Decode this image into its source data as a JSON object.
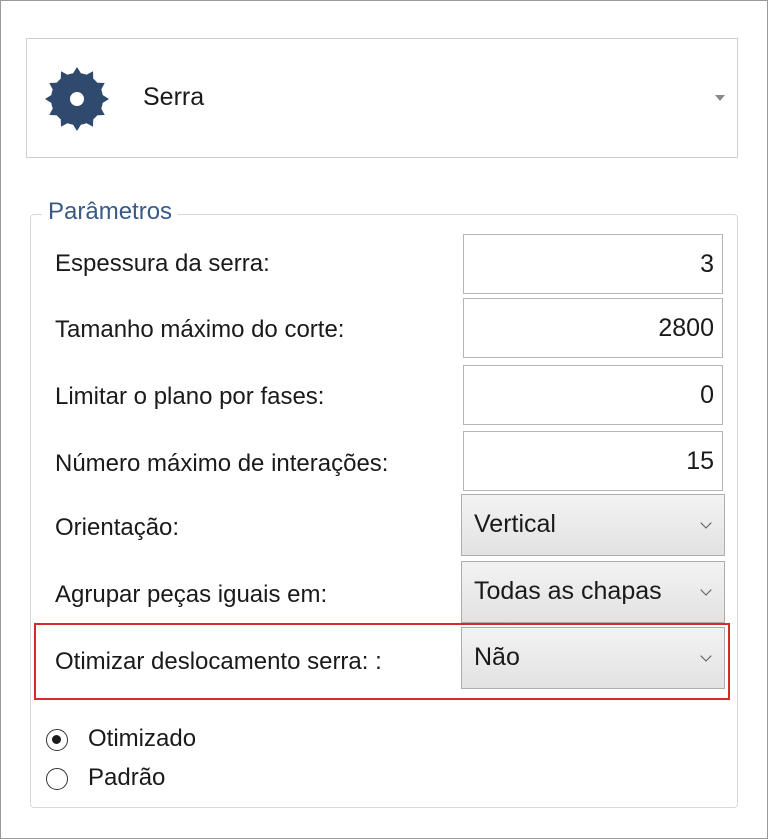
{
  "tool": {
    "icon": "saw-blade-icon",
    "name": "Serra"
  },
  "parameters": {
    "title": "Parâmetros",
    "thickness": {
      "label": "Espessura da serra:",
      "value": "3"
    },
    "max_cut": {
      "label": "Tamanho máximo do corte:",
      "value": "2800"
    },
    "limit_phases": {
      "label": "Limitar o plano por fases:",
      "value": "0"
    },
    "max_iterations": {
      "label": "Número máximo de interações:",
      "value": "15"
    },
    "orientation": {
      "label": "Orientação:",
      "value": "Vertical"
    },
    "group_parts": {
      "label": "Agrupar peças iguais em:",
      "value": "Todas as chapas"
    },
    "optimize_saw": {
      "label": "Otimizar deslocamento serra: :",
      "value": "Não"
    }
  },
  "mode": {
    "options": [
      "Otimizado",
      "Padrão"
    ],
    "selected": "Otimizado"
  },
  "colors": {
    "accent_title": "#3a5a85",
    "icon": "#2f4a6d",
    "highlight": "#d22c2c"
  }
}
